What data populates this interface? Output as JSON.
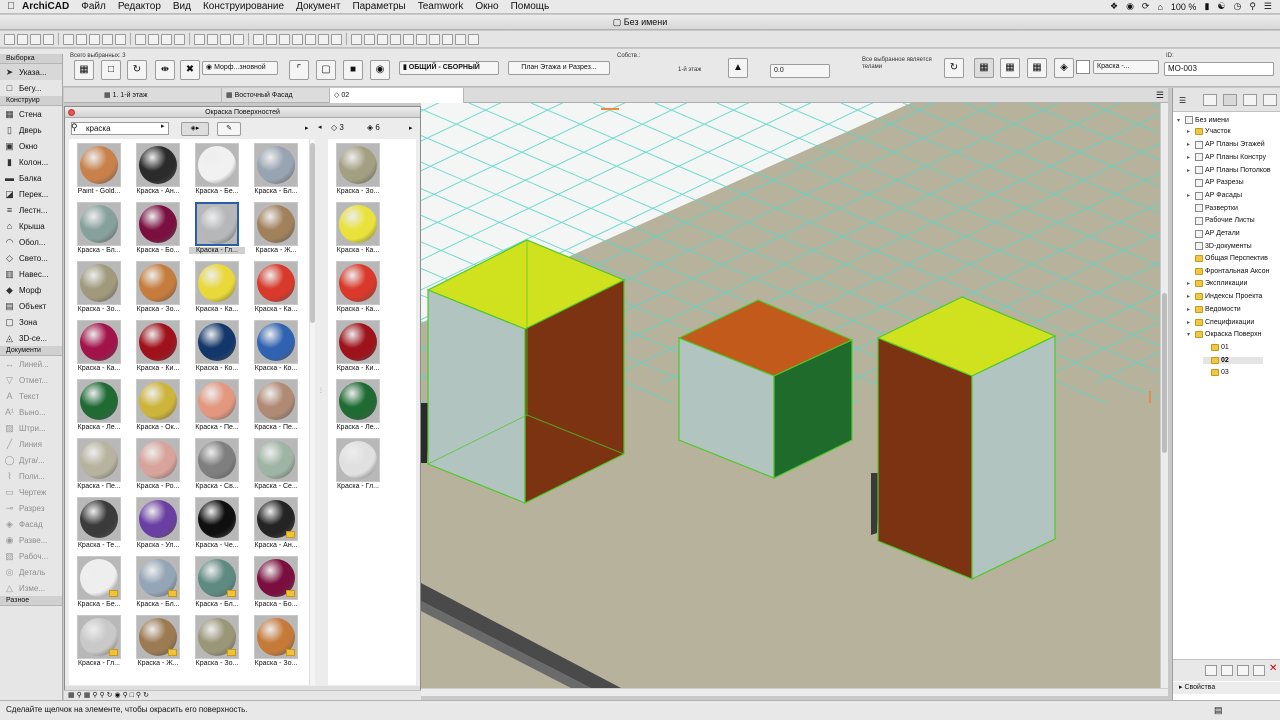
{
  "menubar": {
    "app": "ArchiCAD",
    "items": [
      "Файл",
      "Редактор",
      "Вид",
      "Конструирование",
      "Документ",
      "Параметры",
      "Teamwork",
      "Окно",
      "Помощь"
    ],
    "battery": "100 %"
  },
  "window": {
    "title": "Без имени"
  },
  "infobox": {
    "selected_label": "Всего выбранных: 3",
    "morph_label": "Морф...зновной",
    "layer_label": "ОБЩИЙ - СБОРНЫЙ",
    "floorplan_button": "План Этажа и Разрез...",
    "props_label": "Собств.:",
    "story_label": "1-й этаж",
    "offset_value": "0.0",
    "surface_note": "Все выбранное является телами",
    "material_label": "Краска -...",
    "id_label": "ID:",
    "id_value": "MO-003"
  },
  "tabs": [
    {
      "label": "1. 1-й этаж"
    },
    {
      "label": "Восточный Фасад"
    },
    {
      "label": "02"
    }
  ],
  "toolbox": {
    "header_select": "Выборка",
    "tools_top": [
      {
        "label": "Указа...",
        "icon": "arrow-pointer-icon"
      },
      {
        "label": "Бегу...",
        "icon": "marquee-icon"
      }
    ],
    "header_design": "Конструир",
    "design_tools": [
      {
        "label": "Стена",
        "icon": "wall-icon"
      },
      {
        "label": "Дверь",
        "icon": "door-icon"
      },
      {
        "label": "Окно",
        "icon": "window-icon"
      },
      {
        "label": "Колон...",
        "icon": "column-icon"
      },
      {
        "label": "Балка",
        "icon": "beam-icon"
      },
      {
        "label": "Перек...",
        "icon": "slab-icon"
      },
      {
        "label": "Лестн...",
        "icon": "stair-icon"
      },
      {
        "label": "Крыша",
        "icon": "roof-icon"
      },
      {
        "label": "Обол...",
        "icon": "shell-icon"
      },
      {
        "label": "Свето...",
        "icon": "skylight-icon"
      },
      {
        "label": "Навес...",
        "icon": "curtainwall-icon"
      },
      {
        "label": "Морф",
        "icon": "morph-icon"
      },
      {
        "label": "Объект",
        "icon": "object-icon"
      },
      {
        "label": "Зона",
        "icon": "zone-icon"
      },
      {
        "label": "3D-се...",
        "icon": "mesh-icon"
      }
    ],
    "header_document": "Документи",
    "document_tools": [
      {
        "label": "Линей...",
        "icon": "dimension-icon"
      },
      {
        "label": "Отмет...",
        "icon": "level-icon"
      },
      {
        "label": "Текст",
        "icon": "text-icon"
      },
      {
        "label": "Выно...",
        "icon": "label-icon"
      },
      {
        "label": "Штри...",
        "icon": "fill-icon"
      },
      {
        "label": "Линия",
        "icon": "line-icon"
      },
      {
        "label": "Дуга/...",
        "icon": "arc-icon"
      },
      {
        "label": "Поли...",
        "icon": "polyline-icon"
      },
      {
        "label": "Чертеж",
        "icon": "drawing-icon"
      },
      {
        "label": "Разрез",
        "icon": "section-icon"
      },
      {
        "label": "Фасад",
        "icon": "elevation-icon"
      },
      {
        "label": "Разве...",
        "icon": "interior-icon"
      },
      {
        "label": "Рабоч...",
        "icon": "worksheet-icon"
      },
      {
        "label": "Деталь",
        "icon": "detail-icon"
      },
      {
        "label": "Изме...",
        "icon": "change-icon"
      }
    ],
    "header_more": "Разное"
  },
  "palette": {
    "title": "Окраска Поверхностей",
    "search_value": "краска",
    "counts": {
      "scene": "3",
      "picked": "6"
    },
    "swatches": [
      {
        "label": "Paint - Gold...",
        "color": "#c8814b",
        "mark": false
      },
      {
        "label": "Краска - Ан...",
        "color": "#2b2b2b",
        "mark": false
      },
      {
        "label": "Краска - Бе...",
        "color": "#f1f1f1",
        "mark": false
      },
      {
        "label": "Краска - Бл...",
        "color": "#98a4b1",
        "mark": false
      },
      {
        "label": "Краска - Бл...",
        "color": "#86a09c",
        "mark": false
      },
      {
        "label": "Краска - Бо...",
        "color": "#7a0f40",
        "mark": false
      },
      {
        "label": "Краска - Гл...",
        "color": "#b5b7b9",
        "mark": false,
        "selected": true
      },
      {
        "label": "Краска - Ж...",
        "color": "#a1815c",
        "mark": false
      },
      {
        "label": "Краска - Зо...",
        "color": "#a0997c",
        "mark": false
      },
      {
        "label": "Краска - Зо...",
        "color": "#c57c3c",
        "mark": false
      },
      {
        "label": "Краска - Ка...",
        "color": "#e8d83a",
        "mark": false
      },
      {
        "label": "Краска - Ка...",
        "color": "#d8392a",
        "mark": false
      },
      {
        "label": "Краска - Ка...",
        "color": "#a2134a",
        "mark": false
      },
      {
        "label": "Краска - Ки...",
        "color": "#a0121b",
        "mark": false
      },
      {
        "label": "Краска - Ко...",
        "color": "#13376b",
        "mark": false
      },
      {
        "label": "Краска - Ко...",
        "color": "#2f63b2",
        "mark": false
      },
      {
        "label": "Краска - Ле...",
        "color": "#1f6b33",
        "mark": false
      },
      {
        "label": "Краска - Ок...",
        "color": "#cdb43b",
        "mark": false
      },
      {
        "label": "Краска - Пе...",
        "color": "#e2977f",
        "mark": false
      },
      {
        "label": "Краска - Пе...",
        "color": "#b08a75",
        "mark": false
      },
      {
        "label": "Краска - Пе...",
        "color": "#b6b39e",
        "mark": false
      },
      {
        "label": "Краска - Ро...",
        "color": "#d7a39a",
        "mark": false
      },
      {
        "label": "Краска - Св...",
        "color": "#7f7f7f",
        "mark": false
      },
      {
        "label": "Краска - Се...",
        "color": "#9eb4a4",
        "mark": false
      },
      {
        "label": "Краска - Те...",
        "color": "#3b3b3b",
        "mark": false
      },
      {
        "label": "Краска - Ул...",
        "color": "#6a3fa3",
        "mark": false
      },
      {
        "label": "Краска - Че...",
        "color": "#0f0f0f",
        "mark": false
      },
      {
        "label": "Краска - Ан...",
        "color": "#242424",
        "mark": true
      },
      {
        "label": "Краска - Бе...",
        "color": "#eeeeee",
        "mark": true
      },
      {
        "label": "Краска - Бл...",
        "color": "#93a5b6",
        "mark": true
      },
      {
        "label": "Краска - Бл...",
        "color": "#5f8a82",
        "mark": true
      },
      {
        "label": "Краска - Бо...",
        "color": "#7a0e3e",
        "mark": true
      },
      {
        "label": "Краска - Гл...",
        "color": "#c9c9c9",
        "mark": true
      },
      {
        "label": "Краска - Ж...",
        "color": "#9c7a52",
        "mark": true
      },
      {
        "label": "Краска - Зо...",
        "color": "#9a9778",
        "mark": true
      },
      {
        "label": "Краска - Зо...",
        "color": "#c67a3a",
        "mark": true
      }
    ],
    "picked": [
      {
        "label": "Краска - Зо...",
        "color": "#a39f82"
      },
      {
        "label": "Краска - Ка...",
        "color": "#e8e23a"
      },
      {
        "label": "Краска - Ка...",
        "color": "#d8392a"
      },
      {
        "label": "Краска - Ки...",
        "color": "#9e121b"
      },
      {
        "label": "Краска - Ле...",
        "color": "#1f6b33"
      },
      {
        "label": "Краска - Гл...",
        "color": "#e0e0e0"
      }
    ]
  },
  "navigator": {
    "root": "Без имени",
    "items": [
      {
        "label": "Участок",
        "type": "folder"
      },
      {
        "label": "АР Планы Этажей",
        "type": "page"
      },
      {
        "label": "АР Планы Констру",
        "type": "page"
      },
      {
        "label": "АР Планы Потолков",
        "type": "page"
      },
      {
        "label": "АР Разрезы",
        "type": "page"
      },
      {
        "label": "АР Фасады",
        "type": "page"
      },
      {
        "label": "Развертки",
        "type": "page"
      },
      {
        "label": "Рабочие Листы",
        "type": "page"
      },
      {
        "label": "АР Детали",
        "type": "page"
      },
      {
        "label": "3D-документы",
        "type": "page"
      },
      {
        "label": "Общая Перспектив",
        "type": "folder"
      },
      {
        "label": "Фронтальная Аксон",
        "type": "folder"
      },
      {
        "label": "Экспликации",
        "type": "folder"
      },
      {
        "label": "Индексы Проекта",
        "type": "folder"
      },
      {
        "label": "Ведомости",
        "type": "folder"
      },
      {
        "label": "Спецификации",
        "type": "folder"
      },
      {
        "label": "Окраска Поверхн",
        "type": "folder"
      },
      {
        "label": "01",
        "type": "folder"
      },
      {
        "label": "02",
        "type": "folder",
        "bold": true
      },
      {
        "label": "03",
        "type": "folder"
      }
    ],
    "properties": "Свойства"
  },
  "status": {
    "text": "Сделайте щелчок на элементе, чтобы окрасить его поверхность."
  },
  "colors": {
    "viewport_bg": "#b7b29c",
    "grid": "#56d8c6",
    "yellow_top": "#cfe21d",
    "orange_top": "#c25a1c",
    "brown_side": "#7b3312",
    "green_side": "#1e6b2c",
    "glass_side": "#b2c4c0",
    "edge": "#4ec82b"
  }
}
